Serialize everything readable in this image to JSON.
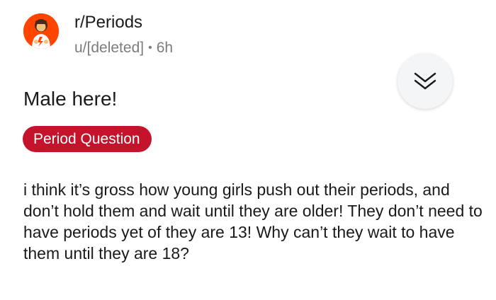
{
  "post": {
    "subreddit": "r/Periods",
    "author": "u/[deleted]",
    "separator": "•",
    "age": "6h",
    "title": "Male here!",
    "flair": "Period Question",
    "body": "i think it’s gross how young girls push out their periods, and don’t hold them and wait until they are older! They don’t need to have periods yet of they are 13! Why can’t they wait to have them until they are 18?"
  },
  "icons": {
    "avatar": "subreddit-avatar-icon",
    "collapse": "double-chevron-down-icon"
  },
  "colors": {
    "avatar_bg": "#ff4500",
    "flair_bg": "#c4132a",
    "flair_text": "#ffffff",
    "meta_text": "#7c7c7c"
  }
}
